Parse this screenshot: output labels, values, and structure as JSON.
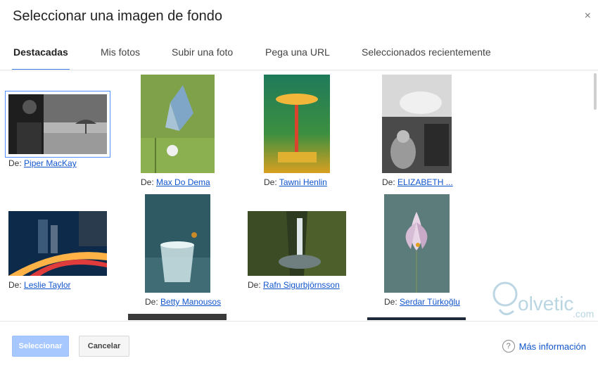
{
  "dialog": {
    "title": "Seleccionar una imagen de fondo",
    "close_glyph": "×"
  },
  "tabs": [
    {
      "label": "Destacadas",
      "active": true
    },
    {
      "label": "Mis fotos",
      "active": false
    },
    {
      "label": "Subir una foto",
      "active": false
    },
    {
      "label": "Pega una URL",
      "active": false
    },
    {
      "label": "Seleccionados recientemente",
      "active": false
    }
  ],
  "gallery": {
    "prefix": "De:",
    "items": [
      {
        "author": "Piper MacKay",
        "selected": true
      },
      {
        "author": "Max Do Dema"
      },
      {
        "author": "Tawni Henlin"
      },
      {
        "author": "ELIZABETH ..."
      },
      {
        "author": "Leslie Taylor"
      },
      {
        "author": "Betty Manousos"
      },
      {
        "author": "Rafn Sigurbjörnsson"
      },
      {
        "author": "Serdar Türkoğlu"
      }
    ]
  },
  "footer": {
    "select_label": "Seleccionar",
    "cancel_label": "Cancelar",
    "more_info_label": "Más información",
    "help_glyph": "?"
  },
  "watermark": {
    "brand": "olvetic",
    "domain": ".com"
  },
  "colors": {
    "accent": "#4285f4",
    "link": "#1155cc",
    "primary_disabled": "#a6c8ff"
  }
}
